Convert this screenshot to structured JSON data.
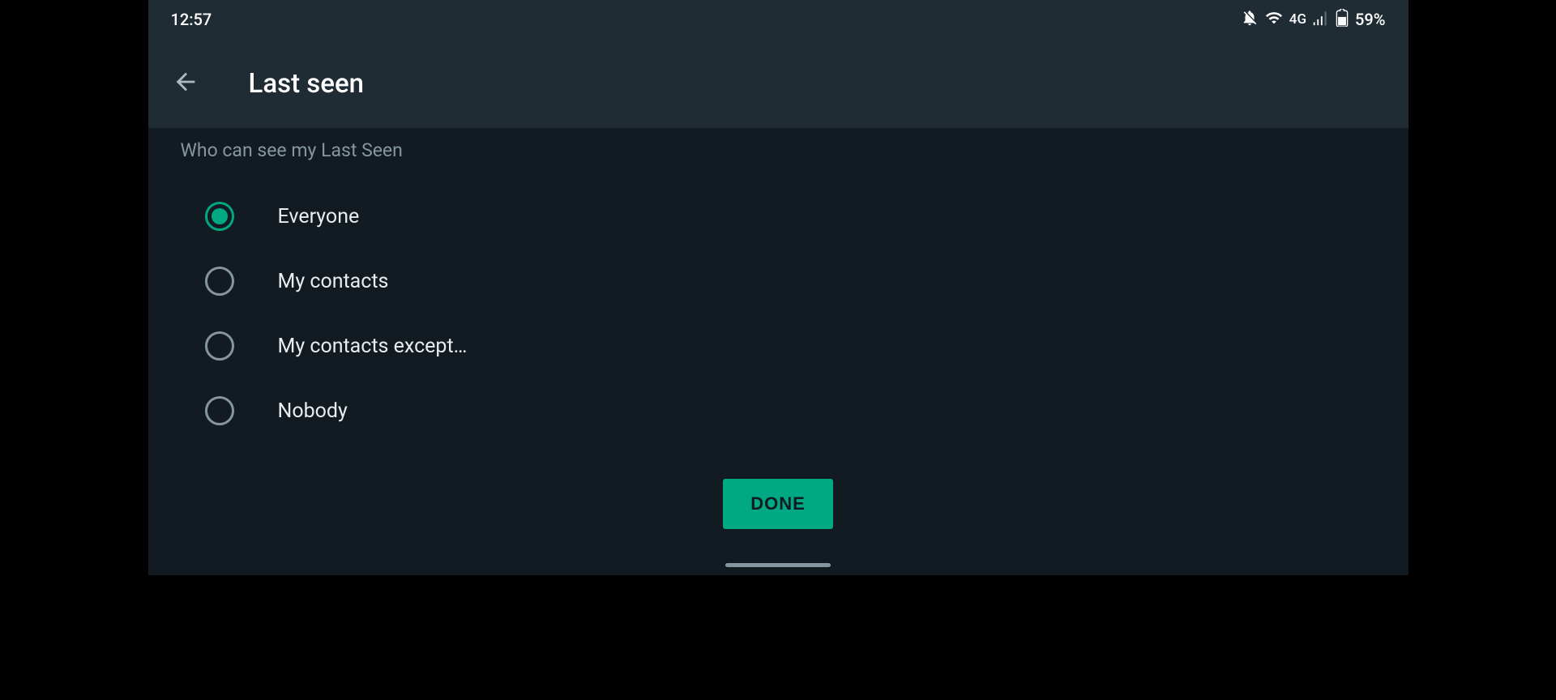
{
  "status": {
    "time": "12:57",
    "network": "4G",
    "battery": "59%"
  },
  "header": {
    "title": "Last seen"
  },
  "section": {
    "title": "Who can see my Last Seen"
  },
  "options": [
    {
      "label": "Everyone",
      "selected": true
    },
    {
      "label": "My contacts",
      "selected": false
    },
    {
      "label": "My contacts except…",
      "selected": false
    },
    {
      "label": "Nobody",
      "selected": false
    }
  ],
  "actions": {
    "done": "DONE"
  }
}
